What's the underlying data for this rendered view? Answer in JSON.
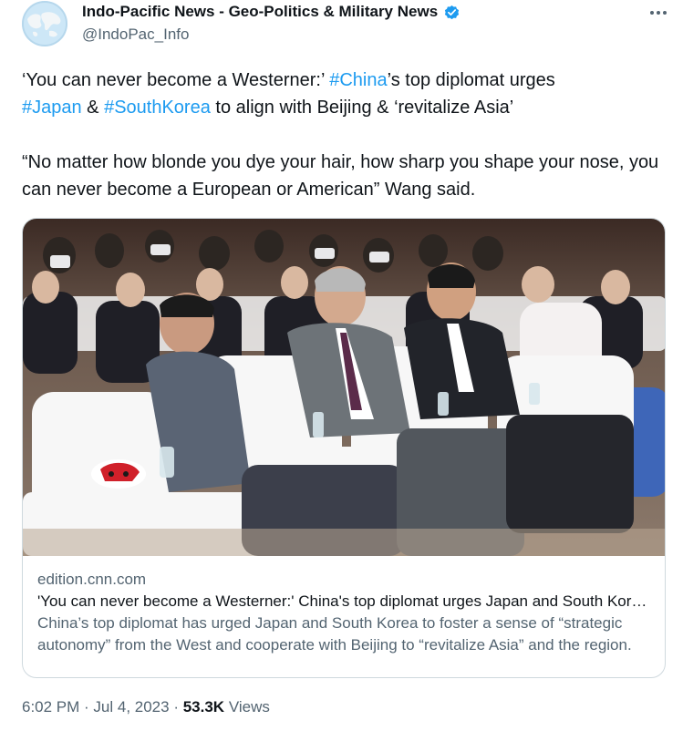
{
  "author": {
    "display_name": "Indo-Pacific News - Geo-Politics & Military News",
    "handle": "@IndoPac_Info",
    "verified": true,
    "avatar_icon": "world-map-avatar"
  },
  "tweet": {
    "line1_part1": "‘You can never become a Westerner:’ ",
    "tag_china": "#China",
    "line1_part2": "’s top diplomat urges",
    "tag_japan": "#Japan",
    "amp": " & ",
    "tag_southkorea": "#SouthKorea",
    "line2_part2": " to align with Beijing & ‘revitalize Asia’",
    "quote": "“No matter how blonde you dye your hair, how sharp you shape your nose, you can never become a European or American” Wang said."
  },
  "card": {
    "domain": "edition.cnn.com",
    "title": "'You can never become a Westerner:' China's top diplomat urges Japan and South Korea to align with Beijing and 'revitalize Asia'",
    "description": "China’s top diplomat has urged Japan and South Korea to foster a sense of “strategic autonomy” from the West and cooperate with Beijing to “revitalize Asia” and the region."
  },
  "meta": {
    "time": "6:02 PM",
    "separator1": " · ",
    "date": "Jul 4, 2023",
    "separator2": " · ",
    "views_count": "53.3K",
    "views_label": " Views"
  },
  "colors": {
    "link": "#1d9bf0",
    "text": "#0f1419",
    "secondary": "#536471",
    "border": "#cfd9de",
    "verified": "#1d9bf0"
  }
}
